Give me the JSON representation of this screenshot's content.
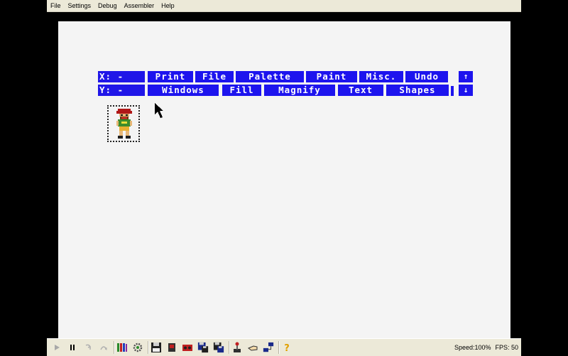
{
  "menu": [
    "File",
    "Settings",
    "Debug",
    "Assembler",
    "Help"
  ],
  "toolbar": {
    "x_label": "X: -",
    "y_label": "Y: -",
    "row1": [
      "Print",
      "File",
      "Palette",
      "Paint",
      "Misc.",
      "Undo"
    ],
    "row2": [
      "Windows",
      "Fill",
      "Magnify",
      "Text",
      "Shapes"
    ],
    "scroll_up": "↑",
    "scroll_down": "↓"
  },
  "bottom_buttons": [
    "play-icon",
    "pause-icon",
    "step-icon",
    "step-over-icon",
    "books-icon",
    "settings-gear-icon",
    "floppy-disk-icon",
    "cartridge-icon",
    "tape-icon",
    "save-state-icon",
    "load-state-icon",
    "joystick-icon",
    "hand-icon",
    "network-icon",
    "help-icon"
  ],
  "status": {
    "speed": "Speed:100%",
    "fps": "FPS: 50"
  },
  "colors": {
    "toolbar_blue": "#1d14ee",
    "screen_bg": "#f4f4f4",
    "chrome": "#ece9d8"
  }
}
